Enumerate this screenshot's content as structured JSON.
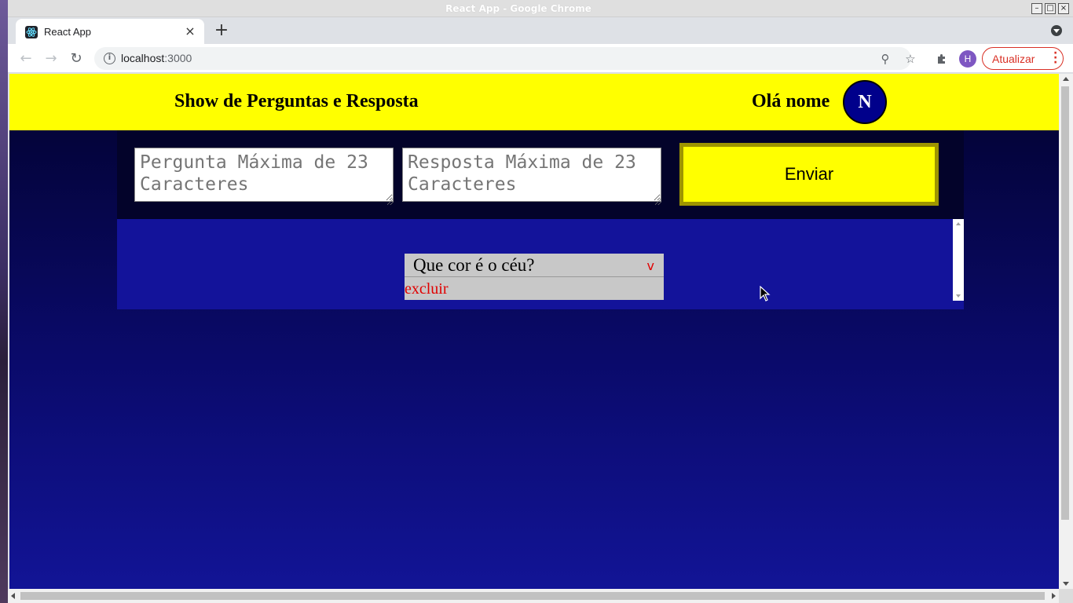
{
  "window": {
    "title": "React App - Google Chrome",
    "buttons": {
      "minimize": "–",
      "maximize": "□",
      "close": "×"
    }
  },
  "browser": {
    "tab": {
      "title": "React App",
      "close": "×"
    },
    "new_tab": "+",
    "url_host": "localhost",
    "url_port": ":3000",
    "profile_initial": "H",
    "update_label": "Atualizar",
    "icons": {
      "back": "arrow-left-icon",
      "forward": "arrow-right-icon",
      "reload": "reload-icon",
      "site_info": "info-icon",
      "zoom": "zoom-icon",
      "bookmark": "star-icon",
      "extensions": "puzzle-icon",
      "menu": "kebab-menu-icon"
    }
  },
  "app": {
    "title": "Show de Perguntas e Resposta",
    "greeting": "Olá nome",
    "avatar_initial": "N",
    "form": {
      "question_placeholder": "Pergunta Máxima de 23 Caracteres",
      "answer_placeholder": "Resposta Máxima de 23 Caracteres",
      "submit_label": "Enviar"
    },
    "cards": [
      {
        "question": "Que cor é o céu?",
        "toggle": "v",
        "delete_label": "excluir"
      }
    ],
    "colors": {
      "header_bg": "#ffff00",
      "avatar_bg": "#00008b",
      "card_bg": "#c8c8c8",
      "danger": "#e00000",
      "page_bg_top": "#02022e",
      "page_bg_bottom": "#121496"
    }
  }
}
